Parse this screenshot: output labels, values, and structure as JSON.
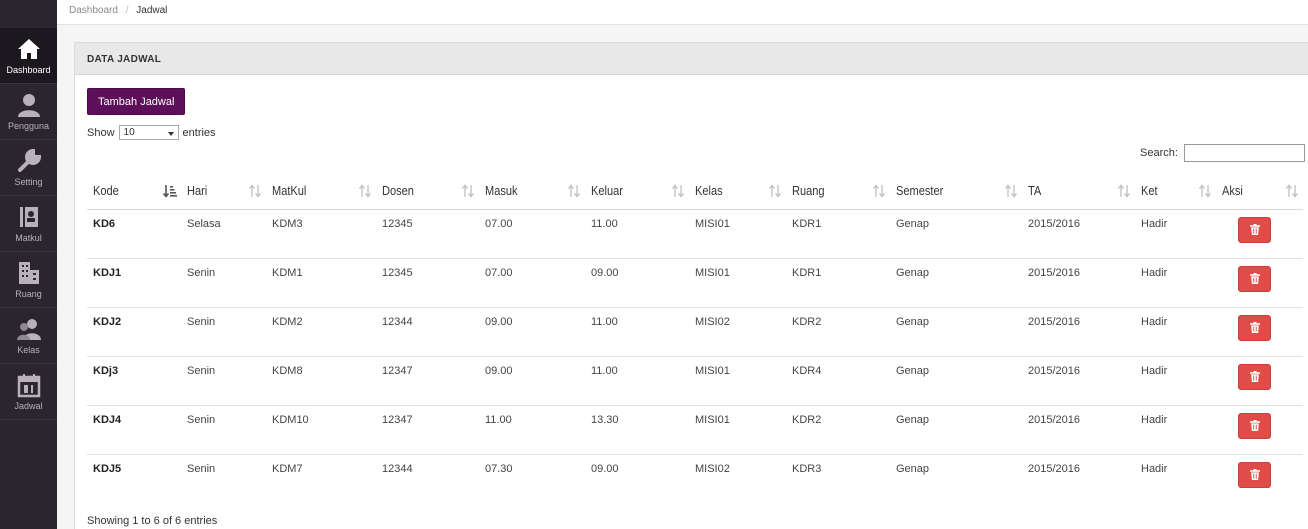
{
  "breadcrumb": {
    "home": "Dashboard",
    "current": "Jadwal"
  },
  "sidebar": {
    "items": [
      {
        "label": "Dashboard",
        "icon": "home-icon",
        "active": true
      },
      {
        "label": "Pengguna",
        "icon": "user-icon"
      },
      {
        "label": "Setting",
        "icon": "wrench-icon"
      },
      {
        "label": "Matkul",
        "icon": "book-icon"
      },
      {
        "label": "Ruang",
        "icon": "building-icon"
      },
      {
        "label": "Kelas",
        "icon": "group-icon"
      },
      {
        "label": "Jadwal",
        "icon": "calendar-icon"
      }
    ]
  },
  "panel": {
    "title": "DATA JADWAL",
    "add_label": "Tambah Jadwal"
  },
  "length": {
    "show": "Show",
    "value": "10",
    "entries": "entries"
  },
  "search": {
    "label": "Search:"
  },
  "table": {
    "headers": [
      "Kode",
      "Hari",
      "MatKul",
      "Dosen",
      "Masuk",
      "Keluar",
      "Kelas",
      "Ruang",
      "Semester",
      "TA",
      "Ket",
      "Aksi"
    ],
    "rows": [
      [
        "KD6",
        "Selasa",
        "KDM3",
        "12345",
        "07.00",
        "11.00",
        "MISI01",
        "KDR1",
        "Genap",
        "2015/2016",
        "Hadir"
      ],
      [
        "KDJ1",
        "Senin",
        "KDM1",
        "12345",
        "07.00",
        "09.00",
        "MISI01",
        "KDR1",
        "Genap",
        "2015/2016",
        "Hadir"
      ],
      [
        "KDJ2",
        "Senin",
        "KDM2",
        "12344",
        "09.00",
        "11.00",
        "MISI02",
        "KDR2",
        "Genap",
        "2015/2016",
        "Hadir"
      ],
      [
        "KDj3",
        "Senin",
        "KDM8",
        "12347",
        "09.00",
        "11.00",
        "MISI01",
        "KDR4",
        "Genap",
        "2015/2016",
        "Hadir"
      ],
      [
        "KDJ4",
        "Senin",
        "KDM10",
        "12347",
        "11.00",
        "13.30",
        "MISI01",
        "KDR2",
        "Genap",
        "2015/2016",
        "Hadir"
      ],
      [
        "KDJ5",
        "Senin",
        "KDM7",
        "12344",
        "07.30",
        "09.00",
        "MISI02",
        "KDR3",
        "Genap",
        "2015/2016",
        "Hadir"
      ]
    ],
    "delete_icon": "trash-icon"
  },
  "info": "Showing 1 to 6 of 6 entries",
  "colors": {
    "sidebar": "#2b2530",
    "primary": "#5e0f5a",
    "danger": "#e04c48"
  }
}
